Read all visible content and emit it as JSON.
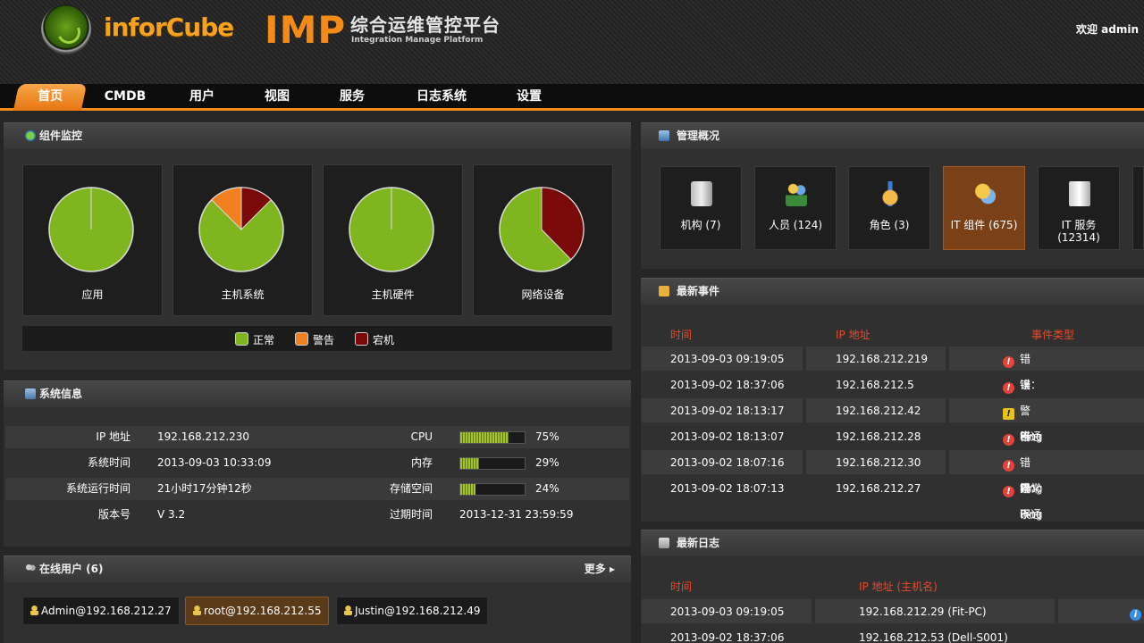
{
  "header": {
    "brand": "inforCube",
    "product": "IMP",
    "title_cn": "综合运维管控平台",
    "title_en": "Integration Manage Platform",
    "welcome": "欢迎 admin"
  },
  "nav": {
    "active": "首页",
    "items": [
      "首页",
      "CMDB",
      "用户",
      "视图",
      "服务",
      "日志系统",
      "设置"
    ]
  },
  "component_monitor": {
    "title": "组件监控",
    "pies": [
      {
        "label": "应用",
        "normal": 100,
        "warning": 0,
        "down": 0
      },
      {
        "label": "主机系统",
        "normal": 75,
        "warning": 12.5,
        "down": 12.5
      },
      {
        "label": "主机硬件",
        "normal": 100,
        "warning": 0,
        "down": 0
      },
      {
        "label": "网络设备",
        "normal": 62,
        "warning": 0,
        "down": 38
      }
    ],
    "legend": {
      "normal": "正常",
      "warning": "警告",
      "down": "宕机"
    },
    "colors": {
      "normal": "#7fb51f",
      "warning": "#f07f20",
      "down": "#7a0a0a"
    }
  },
  "system_info": {
    "title": "系统信息",
    "rows": [
      {
        "k1": "IP 地址",
        "v1": "192.168.212.230",
        "k2": "CPU",
        "pct": 75,
        "v2": "75%"
      },
      {
        "k1": "系统时间",
        "v1": "2013-09-03 10:33:09",
        "k2": "内存",
        "pct": 29,
        "v2": "29%"
      },
      {
        "k1": "系统运行时间",
        "v1": "21小时17分钟12秒",
        "k2": "存储空间",
        "pct": 24,
        "v2": "24%"
      },
      {
        "k1": "版本号",
        "v1": "V 3.2",
        "k2": "过期时间",
        "v2": "2013-12-31 23:59:59"
      }
    ]
  },
  "online_users": {
    "title": "在线用户 (6)",
    "more": "更多 ▸",
    "users": [
      "Admin@192.168.212.27",
      "root@192.168.212.55",
      "Justin@192.168.212.49"
    ]
  },
  "management": {
    "title": "管理概况",
    "items": [
      {
        "label": "机构 (7)",
        "icon": "building-icon"
      },
      {
        "label": "人员 (124)",
        "icon": "people-icon"
      },
      {
        "label": "角色 (3)",
        "icon": "role-icon"
      },
      {
        "label": "IT 组件 (675)",
        "icon": "component-icon"
      },
      {
        "label": "IT 服务 (12314)",
        "icon": "server-icon"
      }
    ]
  },
  "latest_events": {
    "title": "最新事件",
    "headers": [
      "时间",
      "IP 地址",
      "事件类型"
    ],
    "rows": [
      {
        "time": "2013-09-03 09:19:05",
        "ip": "192.168.212.219",
        "type": "错误：Ping 不通",
        "level": "error"
      },
      {
        "time": "2013-09-02 18:37:06",
        "ip": "192.168.212.5",
        "type": "错误：Ping 不通",
        "level": "error"
      },
      {
        "time": "2013-09-02 18:13:17",
        "ip": "192.168.212.42",
        "type": "警告：容量异常",
        "level": "warning"
      },
      {
        "time": "2013-09-02 18:13:07",
        "ip": "192.168.212.28",
        "type": "错误：Ping 不通",
        "level": "error"
      },
      {
        "time": "2013-09-02 18:07:16",
        "ip": "192.168.212.30",
        "type": "错误：Ping 不通",
        "level": "error"
      },
      {
        "time": "2013-09-02 18:07:13",
        "ip": "192.168.212.27",
        "type": "错误：Ping 不通",
        "level": "error"
      }
    ]
  },
  "latest_logs": {
    "title": "最新日志",
    "headers": [
      "时间",
      "IP 地址 (主机名)"
    ],
    "rows": [
      {
        "time": "2013-09-03 09:19:05",
        "ip": "192.168.212.29 (Fit-PC)"
      },
      {
        "time": "2013-09-02 18:37:06",
        "ip": "192.168.212.53 (Dell-S001)"
      }
    ]
  }
}
